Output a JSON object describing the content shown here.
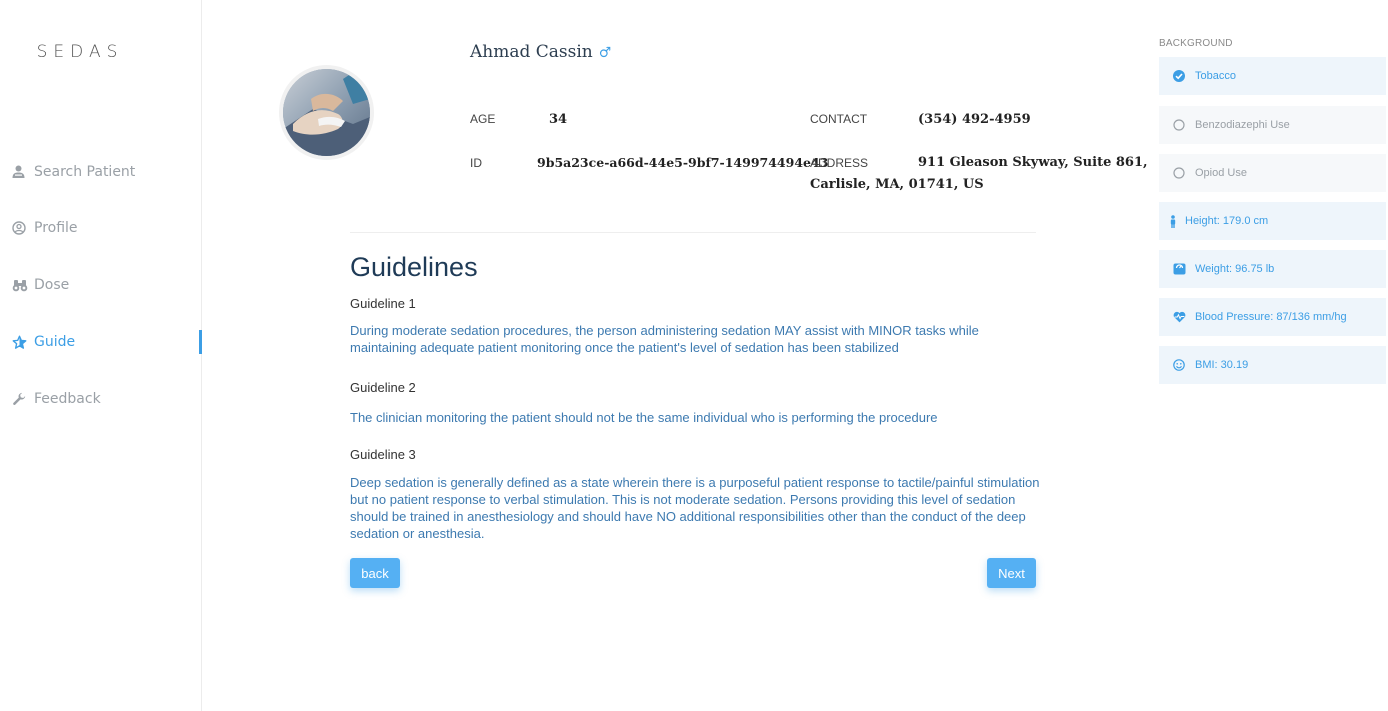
{
  "app": {
    "logo": "SEDAS"
  },
  "sidebar": {
    "items": [
      {
        "label": "Search Patient",
        "icon": "user-search-icon"
      },
      {
        "label": "Profile",
        "icon": "profile-icon"
      },
      {
        "label": "Dose",
        "icon": "binoculars-icon"
      },
      {
        "label": "Guide",
        "icon": "star-icon"
      },
      {
        "label": "Feedback",
        "icon": "wrench-icon"
      }
    ],
    "active_color": "#3c9ee5"
  },
  "patient": {
    "name": "Ahmad Cassin",
    "gender_symbol": "♂",
    "age_label": "AGE",
    "age": "34",
    "id_label": "ID",
    "id": "9b5a23ce-a66d-44e5-9bf7-149974494e43",
    "contact_label": "CONTACT",
    "contact": "(354) 492-4959",
    "address_label": "ADDRESS",
    "address_line1": "911 Gleason Skyway, Suite 861,",
    "address_line2": "Carlisle, MA, 01741, US"
  },
  "guidelines": {
    "title": "Guidelines",
    "items": [
      {
        "heading": "Guideline 1",
        "text": "During moderate sedation procedures, the person administering sedation MAY assist with MINOR tasks while maintaining adequate patient monitoring once the patient's level of sedation has been stabilized"
      },
      {
        "heading": "Guideline 2",
        "text": "The clinician monitoring the patient should not be the same individual who is performing the procedure"
      },
      {
        "heading": "Guideline 3",
        "text": "Deep sedation is generally defined as a state wherein there is a purposeful patient response to tactile/painful stimulation but no patient response to verbal stimulation. This is not moderate sedation. Persons providing this level of sedation should be trained in anesthesiology and should have NO additional responsibilities other than the conduct of the deep sedation or anesthesia."
      }
    ],
    "back_label": "back",
    "next_label": "Next"
  },
  "background": {
    "label": "BACKGROUND",
    "items": [
      {
        "label": "Tobacco",
        "checked": true
      },
      {
        "label": "Benzodiazephi Use",
        "checked": false
      },
      {
        "label": "Opiod Use",
        "checked": false
      }
    ],
    "vitals": [
      {
        "label": "Height: 179.0 cm",
        "icon": "person-icon"
      },
      {
        "label": "Weight: 96.75 lb",
        "icon": "scale-icon"
      },
      {
        "label": "Blood Pressure: 87/136 mm/hg",
        "icon": "heartbeat-icon"
      },
      {
        "label": "BMI: 30.19",
        "icon": "smile-icon"
      }
    ]
  }
}
